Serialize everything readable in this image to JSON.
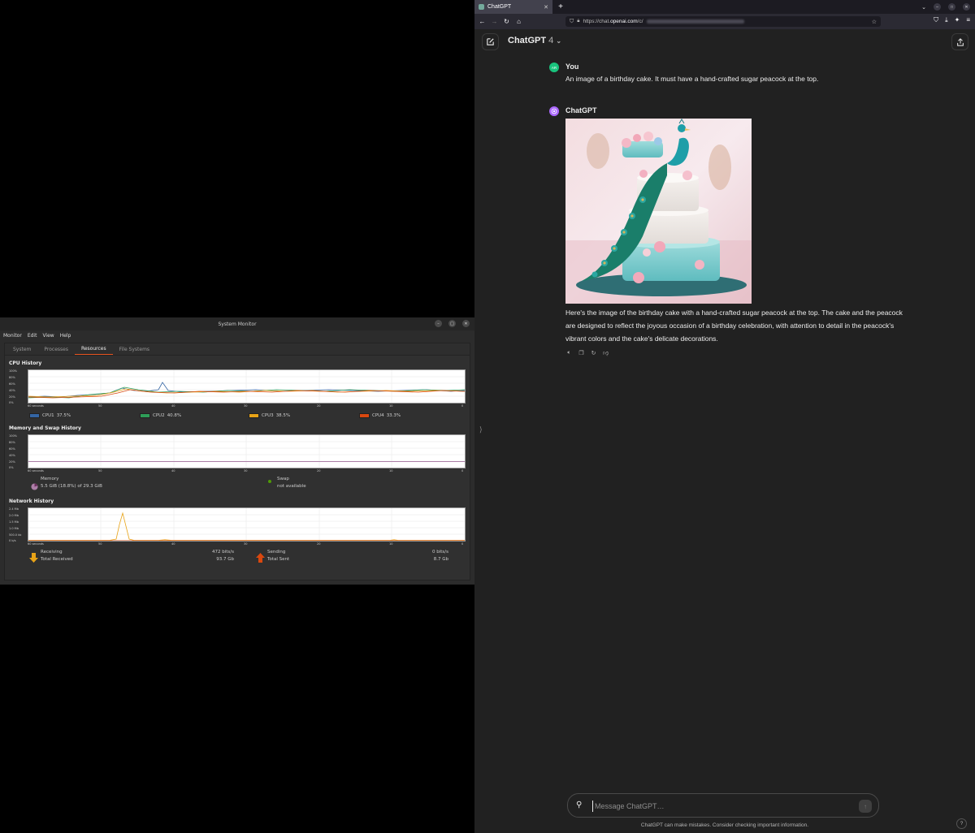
{
  "sysmon": {
    "title": "System Monitor",
    "menu": [
      "Monitor",
      "Edit",
      "View",
      "Help"
    ],
    "tabs": [
      "System",
      "Processes",
      "Resources",
      "File Systems"
    ],
    "active_tab": "Resources",
    "cpu": {
      "title": "CPU History",
      "yticks": [
        "100%",
        "80%",
        "60%",
        "40%",
        "20%",
        "0%"
      ],
      "xticks": [
        "60 seconds",
        "50",
        "40",
        "30",
        "20",
        "10",
        "0"
      ],
      "legend": [
        {
          "label": "CPU1",
          "value": "37.5%",
          "color": "#3465a4"
        },
        {
          "label": "CPU2",
          "value": "40.8%",
          "color": "#2e9e58"
        },
        {
          "label": "CPU3",
          "value": "38.5%",
          "color": "#e8a317"
        },
        {
          "label": "CPU4",
          "value": "33.3%",
          "color": "#d9480f"
        }
      ]
    },
    "memory": {
      "title": "Memory and Swap History",
      "yticks": [
        "100%",
        "80%",
        "60%",
        "40%",
        "20%",
        "0%"
      ],
      "xticks": [
        "60 seconds",
        "50",
        "40",
        "30",
        "20",
        "10",
        "0"
      ],
      "memory_label": "Memory",
      "memory_value": "5.5 GiB (18.8%) of 29.3 GiB",
      "swap_label": "Swap",
      "swap_value": "not available",
      "memory_color": "#ad7fa8",
      "swap_color": "#4e9a06"
    },
    "network": {
      "title": "Network History",
      "yticks": [
        "2.4 Mb",
        "2.0 Mb",
        "1.5 Mb",
        "1.0 Mb",
        "500.0 kb",
        "0 b/s"
      ],
      "xticks": [
        "60 seconds",
        "50",
        "40",
        "30",
        "20",
        "10",
        "0"
      ],
      "receiving_label": "Receiving",
      "receiving_value": "472 bits/s",
      "total_received_label": "Total Received",
      "total_received_value": "93.7 Gb",
      "sending_label": "Sending",
      "sending_value": "0 bits/s",
      "total_sent_label": "Total Sent",
      "total_sent_value": "8.7 Gb"
    }
  },
  "browser": {
    "tab_title": "ChatGPT",
    "url_prefix": "https://chat.",
    "url_domain": "openai.com",
    "url_path": "/c/",
    "model_name": "ChatGPT",
    "model_version": "4",
    "user_initials": "AR",
    "user_name": "You",
    "user_message": "An image of a birthday cake. It must have a hand-crafted sugar peacock at the top.",
    "bot_name": "ChatGPT",
    "bot_message": "Here's the image of the birthday cake with a hand-crafted sugar peacock at the top. The cake and the peacock are designed to reflect the joyous occasion of a birthday celebration, with attention to detail in the peacock's vibrant colors and the cake's delicate decorations.",
    "composer_placeholder": "Message ChatGPT…",
    "disclaimer": "ChatGPT can make mistakes. Consider checking important information.",
    "help": "?"
  }
}
